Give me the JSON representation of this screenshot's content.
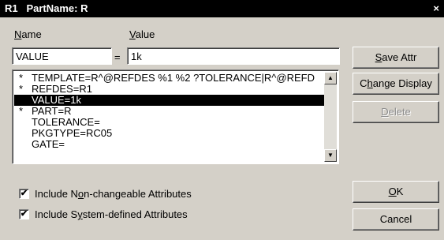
{
  "window": {
    "title": "R1   PartName: R",
    "close_glyph": "×"
  },
  "fields": {
    "name_label_prefix": "",
    "name_label_accel": "N",
    "name_label_rest": "ame",
    "value_label_accel": "V",
    "value_label_rest": "alue",
    "name_value": "VALUE",
    "equals": "=",
    "value_value": "1k"
  },
  "attributes": [
    {
      "mark": "*",
      "text": "TEMPLATE=R^@REFDES %1 %2 ?TOLERANCE|R^@REFD",
      "selected": false
    },
    {
      "mark": "*",
      "text": "REFDES=R1",
      "selected": false
    },
    {
      "mark": "",
      "text": "VALUE=1k",
      "selected": true
    },
    {
      "mark": "*",
      "text": "PART=R",
      "selected": false
    },
    {
      "mark": "",
      "text": "TOLERANCE=",
      "selected": false
    },
    {
      "mark": "",
      "text": "PKGTYPE=RC05",
      "selected": false
    },
    {
      "mark": "",
      "text": "GATE=",
      "selected": false
    }
  ],
  "buttons": {
    "save_accel": "S",
    "save_rest": "ave Attr",
    "change_pre": "C",
    "change_accel": "h",
    "change_rest": "ange Display",
    "delete_accel": "D",
    "delete_rest": "elete",
    "ok_accel": "O",
    "ok_rest": "K",
    "cancel": "Cancel"
  },
  "options": {
    "nonchange_pre": "Include N",
    "nonchange_accel": "o",
    "nonchange_rest": "n-changeable Attributes",
    "nonchange_checked": true,
    "system_pre": "Include S",
    "system_accel": "y",
    "system_rest": "stem-defined Attributes",
    "system_checked": true,
    "check_glyph": "✔"
  },
  "scroll": {
    "up_glyph": "▲",
    "down_glyph": "▼"
  }
}
